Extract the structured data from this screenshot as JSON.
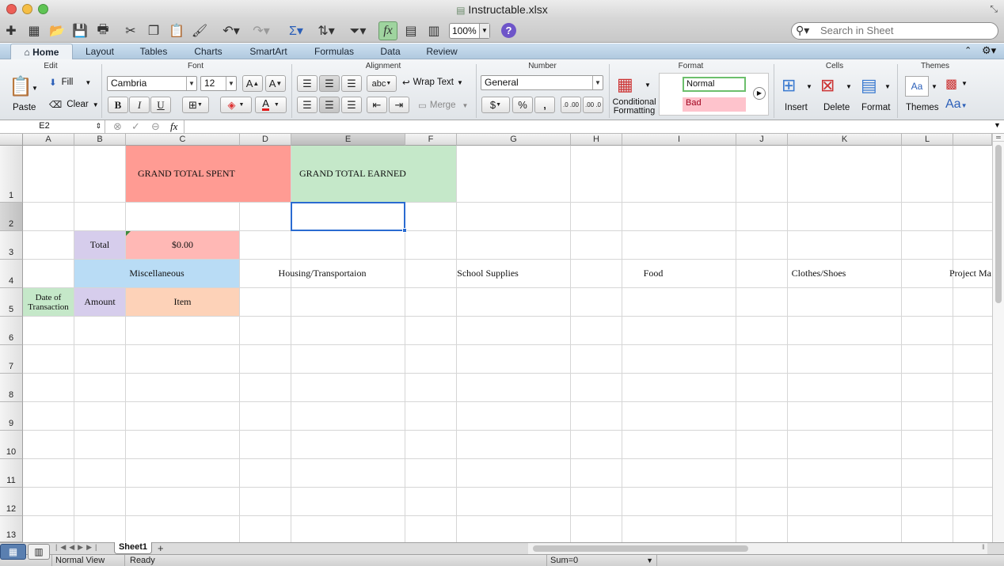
{
  "window": {
    "title": "Instructable.xlsx"
  },
  "toolbar": {
    "zoom": "100%",
    "search_placeholder": "Search in Sheet",
    "help": "?"
  },
  "ribbon_tabs": [
    "Home",
    "Layout",
    "Tables",
    "Charts",
    "SmartArt",
    "Formulas",
    "Data",
    "Review"
  ],
  "ribbon": {
    "groups": {
      "edit": "Edit",
      "font": "Font",
      "alignment": "Alignment",
      "number": "Number",
      "format": "Format",
      "cells": "Cells",
      "themes": "Themes"
    },
    "edit": {
      "paste": "Paste",
      "fill": "Fill",
      "clear": "Clear"
    },
    "font": {
      "name": "Cambria",
      "size": "12",
      "bold": "B",
      "italic": "I",
      "underline": "U",
      "increase": "A",
      "decrease": "A",
      "color": "A"
    },
    "alignment": {
      "orientation": "abc",
      "wrap_text": "Wrap Text",
      "merge": "Merge"
    },
    "number": {
      "format": "General",
      "percent": "%",
      "comma": ",",
      "increase_decimal": ".0 .00",
      "decrease_decimal": ".00 .0"
    },
    "format": {
      "conditional": "Conditional Formatting",
      "style_normal": "Normal",
      "style_bad": "Bad"
    },
    "cells": {
      "insert": "Insert",
      "delete": "Delete",
      "format": "Format"
    },
    "themes": {
      "themes": "Themes",
      "fonts": "Aa"
    }
  },
  "formula_bar": {
    "cell_ref": "E2",
    "fx": "fx",
    "value": ""
  },
  "columns": [
    "A",
    "B",
    "C",
    "D",
    "E",
    "F",
    "G",
    "H",
    "I",
    "J",
    "K",
    "L"
  ],
  "rows": [
    "1",
    "2",
    "3",
    "4",
    "5",
    "6",
    "7",
    "8",
    "9",
    "10",
    "11",
    "12",
    "13"
  ],
  "selected": {
    "column": "E",
    "row": "2"
  },
  "cells": {
    "c1": "GRAND TOTAL SPENT",
    "e1": "GRAND TOTAL EARNED",
    "b3": "Total",
    "c3": "$0.00",
    "c4": "Miscellaneous",
    "e4": "Housing/Transportaion",
    "g4": "School Supplies",
    "i4": "Food",
    "k4": "Clothes/Shoes",
    "l4": "Project Ma",
    "a5": "Date of Transaction",
    "b5": "Amount",
    "c5": "Item"
  },
  "colors": {
    "spent": "#ff9b93",
    "earned": "#c5e8c9",
    "total": "#d6cdec",
    "amount": "#d6cdec",
    "dollars": "#ffb8b5",
    "misc": "#b9dcf5",
    "item": "#fdd2b8",
    "date": "#c5e8c9",
    "selection": "#2a6bd1"
  },
  "sheets": [
    {
      "name": "Sheet1"
    }
  ],
  "status": {
    "view": "Normal View",
    "state": "Ready",
    "sum": "Sum=0"
  }
}
